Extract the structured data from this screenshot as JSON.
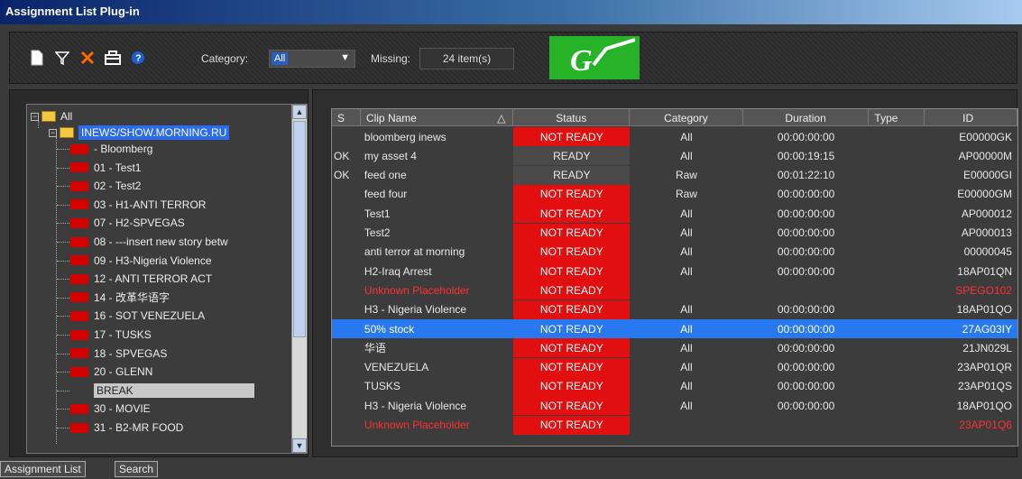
{
  "window": {
    "title": "Assignment List Plug-in"
  },
  "toolbar": {
    "icons": [
      "new-document-icon",
      "filter-icon",
      "delete-icon",
      "toolbox-icon",
      "help-icon"
    ],
    "category_label": "Category:",
    "category_value": "All",
    "missing_label": "Missing:",
    "missing_value": "24 item(s)",
    "logo_text": "GV"
  },
  "tree": {
    "root": "All",
    "show": "INEWS/SHOW.MORNING.RU",
    "items": [
      "- Bloomberg",
      "01 - Test1",
      "02 - Test2",
      "03 - H1-ANTI TERROR",
      "07 - H2-SPVEGAS",
      "08 - ---insert new story betw",
      "09 - H3-Nigeria Violence",
      "12 - ANTI TERROR ACT",
      "14 - 改革华语字",
      "16 - SOT VENEZUELA",
      "17 - TUSKS",
      "18 - SPVEGAS",
      "20 - GLENN",
      "BREAK",
      "30 - MOVIE",
      "31 - B2-MR FOOD"
    ]
  },
  "grid": {
    "columns": [
      "S",
      "Clip Name",
      "Status",
      "Category",
      "Duration",
      "Type",
      "ID"
    ],
    "sort_indicator": "△",
    "rows": [
      {
        "s": "",
        "name": "bloomberg inews",
        "status": "NOT READY",
        "category": "All",
        "duration": "00:00:00:00",
        "type": "",
        "id": "E00000GK"
      },
      {
        "s": "OK",
        "name": "my asset 4",
        "status": "READY",
        "category": "All",
        "duration": "00:00:19:15",
        "type": "",
        "id": "AP00000M"
      },
      {
        "s": "OK",
        "name": "feed one",
        "status": "READY",
        "category": "Raw",
        "duration": "00:01:22:10",
        "type": "",
        "id": "E00000GI"
      },
      {
        "s": "",
        "name": "feed four",
        "status": "NOT READY",
        "category": "Raw",
        "duration": "00:00:00:00",
        "type": "",
        "id": "E00000GM"
      },
      {
        "s": "",
        "name": "Test1",
        "status": "NOT READY",
        "category": "All",
        "duration": "00:00:00:00",
        "type": "",
        "id": "AP000012"
      },
      {
        "s": "",
        "name": "Test2",
        "status": "NOT READY",
        "category": "All",
        "duration": "00:00:00:00",
        "type": "",
        "id": "AP000013"
      },
      {
        "s": "",
        "name": "anti terror at morning",
        "status": "NOT READY",
        "category": "All",
        "duration": "00:00:00:00",
        "type": "",
        "id": "00000045"
      },
      {
        "s": "",
        "name": "H2-Iraq Arrest",
        "status": "NOT READY",
        "category": "All",
        "duration": "00:00:00:00",
        "type": "",
        "id": "18AP01QN"
      },
      {
        "s": "",
        "name": "Unknown Placeholder",
        "status": "NOT READY",
        "category": "",
        "duration": "",
        "type": "",
        "id": "SPEGO102",
        "red": true
      },
      {
        "s": "",
        "name": "H3 - Nigeria Violence",
        "status": "NOT READY",
        "category": "All",
        "duration": "00:00:00:00",
        "type": "",
        "id": "18AP01QO"
      },
      {
        "s": "",
        "name": "50% stock",
        "status": "NOT READY",
        "category": "All",
        "duration": "00:00:00:00",
        "type": "",
        "id": "27AG03IY",
        "selected": true
      },
      {
        "s": "",
        "name": "华语",
        "status": "NOT READY",
        "category": "All",
        "duration": "00:00:00:00",
        "type": "",
        "id": "21JN029L"
      },
      {
        "s": "",
        "name": "VENEZUELA",
        "status": "NOT READY",
        "category": "All",
        "duration": "00:00:00:00",
        "type": "",
        "id": "23AP01QR"
      },
      {
        "s": "",
        "name": "TUSKS",
        "status": "NOT READY",
        "category": "All",
        "duration": "00:00:00:00",
        "type": "",
        "id": "23AP01QS"
      },
      {
        "s": "",
        "name": "H3 - Nigeria Violence",
        "status": "NOT READY",
        "category": "All",
        "duration": "00:00:00:00",
        "type": "",
        "id": "18AP01QO"
      },
      {
        "s": "",
        "name": "Unknown Placeholder",
        "status": "NOT READY",
        "category": "",
        "duration": "",
        "type": "",
        "id": "23AP01Q6",
        "red": true
      }
    ]
  },
  "tabs": [
    "Assignment List",
    "Search"
  ],
  "colors": {
    "status_not_ready": "#e10f0f",
    "selection": "#2878f0",
    "logo_green": "#27b327"
  }
}
